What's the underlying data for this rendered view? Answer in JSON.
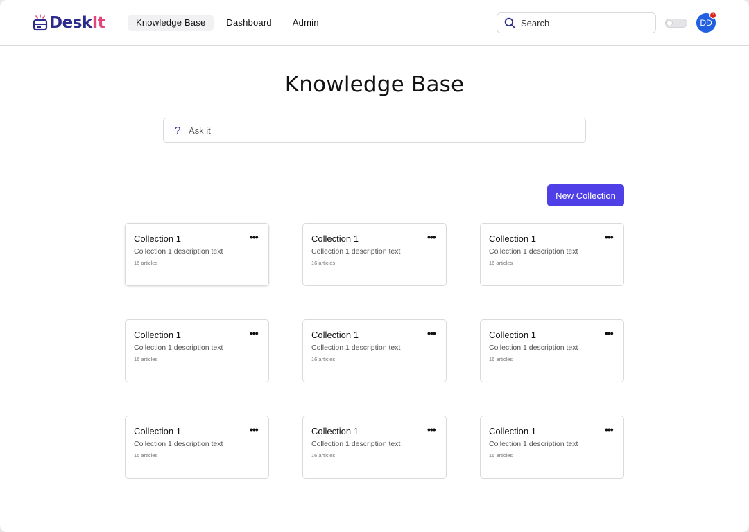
{
  "app": {
    "logo_part1": "Desk",
    "logo_part2": "It",
    "brand_colors": {
      "primary": "#2c2a8c",
      "accent": "#e0457b"
    }
  },
  "nav": {
    "items": [
      {
        "label": "Knowledge Base",
        "active": true
      },
      {
        "label": "Dashboard",
        "active": false
      },
      {
        "label": "Admin",
        "active": false
      }
    ]
  },
  "search": {
    "placeholder": "Search",
    "icon": "search-icon"
  },
  "theme_toggle": {
    "on": false
  },
  "user": {
    "initials": "DD",
    "notification_count": "1",
    "avatar_color": "#1f5fe0"
  },
  "main": {
    "title": "Knowledge Base",
    "ask": {
      "icon": "?",
      "placeholder": "Ask it"
    },
    "new_collection_label": "New Collection",
    "button_color": "#4f3fe6",
    "menu_icon": "•••",
    "collections": [
      {
        "title": "Collection 1",
        "description": "Collection 1 description text",
        "count": "16 articles"
      },
      {
        "title": "Collection 1",
        "description": "Collection 1 description text",
        "count": "16 articles"
      },
      {
        "title": "Collection 1",
        "description": "Collection 1 description text",
        "count": "16 articles"
      },
      {
        "title": "Collection 1",
        "description": "Collection 1 description text",
        "count": "16 articles"
      },
      {
        "title": "Collection 1",
        "description": "Collection 1 description text",
        "count": "16 articles"
      },
      {
        "title": "Collection 1",
        "description": "Collection 1 description text",
        "count": "16 articles"
      },
      {
        "title": "Collection 1",
        "description": "Collection 1 description text",
        "count": "16 articles"
      },
      {
        "title": "Collection 1",
        "description": "Collection 1 description text",
        "count": "16 articles"
      },
      {
        "title": "Collection 1",
        "description": "Collection 1 description text",
        "count": "16 articles"
      }
    ]
  }
}
